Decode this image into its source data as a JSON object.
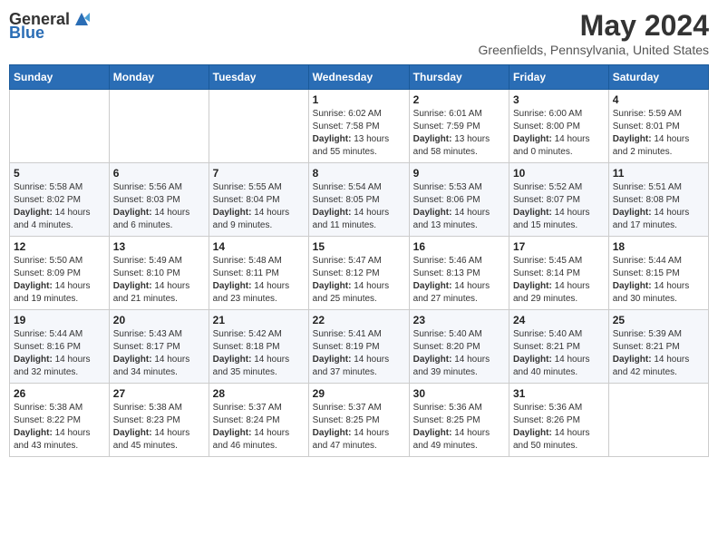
{
  "logo": {
    "general": "General",
    "blue": "Blue"
  },
  "title": "May 2024",
  "subtitle": "Greenfields, Pennsylvania, United States",
  "headers": [
    "Sunday",
    "Monday",
    "Tuesday",
    "Wednesday",
    "Thursday",
    "Friday",
    "Saturday"
  ],
  "weeks": [
    [
      {
        "day": "",
        "info": ""
      },
      {
        "day": "",
        "info": ""
      },
      {
        "day": "",
        "info": ""
      },
      {
        "day": "1",
        "info": "Sunrise: 6:02 AM\nSunset: 7:58 PM\nDaylight: 13 hours and 55 minutes."
      },
      {
        "day": "2",
        "info": "Sunrise: 6:01 AM\nSunset: 7:59 PM\nDaylight: 13 hours and 58 minutes."
      },
      {
        "day": "3",
        "info": "Sunrise: 6:00 AM\nSunset: 8:00 PM\nDaylight: 14 hours and 0 minutes."
      },
      {
        "day": "4",
        "info": "Sunrise: 5:59 AM\nSunset: 8:01 PM\nDaylight: 14 hours and 2 minutes."
      }
    ],
    [
      {
        "day": "5",
        "info": "Sunrise: 5:58 AM\nSunset: 8:02 PM\nDaylight: 14 hours and 4 minutes."
      },
      {
        "day": "6",
        "info": "Sunrise: 5:56 AM\nSunset: 8:03 PM\nDaylight: 14 hours and 6 minutes."
      },
      {
        "day": "7",
        "info": "Sunrise: 5:55 AM\nSunset: 8:04 PM\nDaylight: 14 hours and 9 minutes."
      },
      {
        "day": "8",
        "info": "Sunrise: 5:54 AM\nSunset: 8:05 PM\nDaylight: 14 hours and 11 minutes."
      },
      {
        "day": "9",
        "info": "Sunrise: 5:53 AM\nSunset: 8:06 PM\nDaylight: 14 hours and 13 minutes."
      },
      {
        "day": "10",
        "info": "Sunrise: 5:52 AM\nSunset: 8:07 PM\nDaylight: 14 hours and 15 minutes."
      },
      {
        "day": "11",
        "info": "Sunrise: 5:51 AM\nSunset: 8:08 PM\nDaylight: 14 hours and 17 minutes."
      }
    ],
    [
      {
        "day": "12",
        "info": "Sunrise: 5:50 AM\nSunset: 8:09 PM\nDaylight: 14 hours and 19 minutes."
      },
      {
        "day": "13",
        "info": "Sunrise: 5:49 AM\nSunset: 8:10 PM\nDaylight: 14 hours and 21 minutes."
      },
      {
        "day": "14",
        "info": "Sunrise: 5:48 AM\nSunset: 8:11 PM\nDaylight: 14 hours and 23 minutes."
      },
      {
        "day": "15",
        "info": "Sunrise: 5:47 AM\nSunset: 8:12 PM\nDaylight: 14 hours and 25 minutes."
      },
      {
        "day": "16",
        "info": "Sunrise: 5:46 AM\nSunset: 8:13 PM\nDaylight: 14 hours and 27 minutes."
      },
      {
        "day": "17",
        "info": "Sunrise: 5:45 AM\nSunset: 8:14 PM\nDaylight: 14 hours and 29 minutes."
      },
      {
        "day": "18",
        "info": "Sunrise: 5:44 AM\nSunset: 8:15 PM\nDaylight: 14 hours and 30 minutes."
      }
    ],
    [
      {
        "day": "19",
        "info": "Sunrise: 5:44 AM\nSunset: 8:16 PM\nDaylight: 14 hours and 32 minutes."
      },
      {
        "day": "20",
        "info": "Sunrise: 5:43 AM\nSunset: 8:17 PM\nDaylight: 14 hours and 34 minutes."
      },
      {
        "day": "21",
        "info": "Sunrise: 5:42 AM\nSunset: 8:18 PM\nDaylight: 14 hours and 35 minutes."
      },
      {
        "day": "22",
        "info": "Sunrise: 5:41 AM\nSunset: 8:19 PM\nDaylight: 14 hours and 37 minutes."
      },
      {
        "day": "23",
        "info": "Sunrise: 5:40 AM\nSunset: 8:20 PM\nDaylight: 14 hours and 39 minutes."
      },
      {
        "day": "24",
        "info": "Sunrise: 5:40 AM\nSunset: 8:21 PM\nDaylight: 14 hours and 40 minutes."
      },
      {
        "day": "25",
        "info": "Sunrise: 5:39 AM\nSunset: 8:21 PM\nDaylight: 14 hours and 42 minutes."
      }
    ],
    [
      {
        "day": "26",
        "info": "Sunrise: 5:38 AM\nSunset: 8:22 PM\nDaylight: 14 hours and 43 minutes."
      },
      {
        "day": "27",
        "info": "Sunrise: 5:38 AM\nSunset: 8:23 PM\nDaylight: 14 hours and 45 minutes."
      },
      {
        "day": "28",
        "info": "Sunrise: 5:37 AM\nSunset: 8:24 PM\nDaylight: 14 hours and 46 minutes."
      },
      {
        "day": "29",
        "info": "Sunrise: 5:37 AM\nSunset: 8:25 PM\nDaylight: 14 hours and 47 minutes."
      },
      {
        "day": "30",
        "info": "Sunrise: 5:36 AM\nSunset: 8:25 PM\nDaylight: 14 hours and 49 minutes."
      },
      {
        "day": "31",
        "info": "Sunrise: 5:36 AM\nSunset: 8:26 PM\nDaylight: 14 hours and 50 minutes."
      },
      {
        "day": "",
        "info": ""
      }
    ]
  ]
}
